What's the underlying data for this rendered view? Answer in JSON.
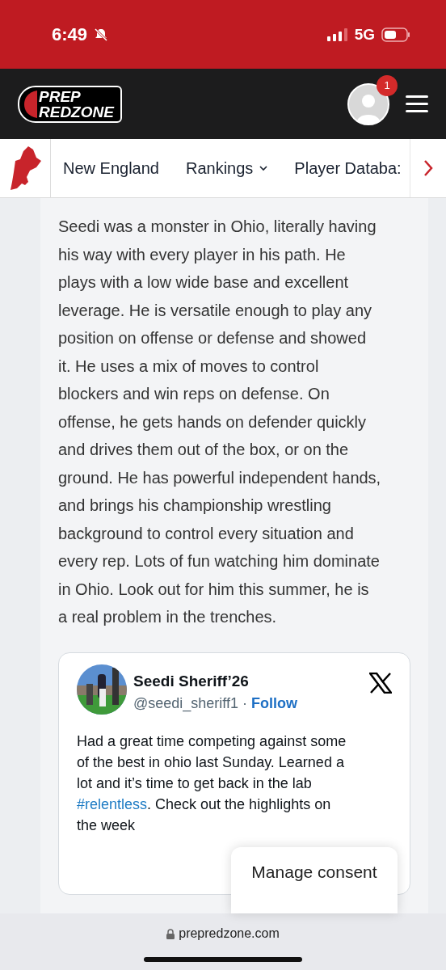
{
  "status_bar": {
    "time": "6:49",
    "network": "5G"
  },
  "header": {
    "logo": {
      "line_1": "PREP",
      "line_2": "REDZONE"
    },
    "notification_count": "1"
  },
  "nav": {
    "items": [
      {
        "label": "New England",
        "kind": "plain"
      },
      {
        "label": "Rankings",
        "kind": "dropdown"
      },
      {
        "label": "Player Databa:",
        "kind": "plain"
      }
    ]
  },
  "article": {
    "paragraph": "Seedi was a monster in Ohio, literally having his way with every player in his path. He plays with a low wide base and excellent leverage. He is versatile enough to play any position on offense or defense and showed it. He uses a mix of moves to control blockers and win reps on defense. On offense, he gets hands on defender quickly and drives them out of the box, or on the ground. He has powerful independent hands, and brings his championship wrestling background to control every situation and every rep. Lots of fun watching him dominate in Ohio. Look out for him this summer, he is a real problem in the trenches."
  },
  "tweet": {
    "name": "Seedi Sheriff’26",
    "handle": "@seedi_sheriff1",
    "separator": "·",
    "follow": "Follow",
    "text_before": "Had a great time competing against some of the best in ohio last Sunday. Learned a lot and it’s time to get back in the lab",
    "hashtag": "#relentless",
    "text_after": ".  Check out the highlights on the week"
  },
  "consent_button": "Manage consent",
  "address_bar": {
    "domain": "prepredzone.com"
  }
}
